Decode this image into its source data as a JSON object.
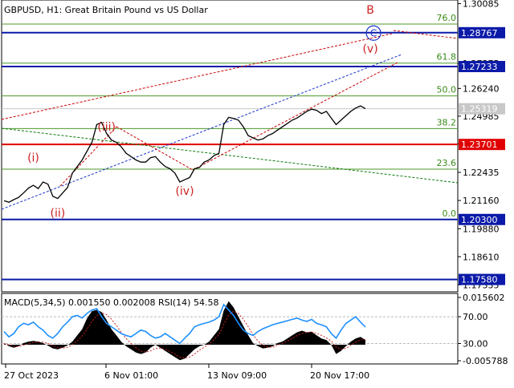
{
  "chart_data": {
    "type": "line",
    "title": "GBPUSD, H1:  Great Britain Pound vs US Dollar",
    "ylim": [
      1.1702,
      1.3025
    ],
    "y_ticks": [
      "1.30085",
      "1.27375",
      "1.26240",
      "1.24985",
      "1.23730",
      "1.22435",
      "1.21160",
      "1.19880",
      "1.18610",
      "1.17335"
    ],
    "x_labels": [
      "27 Oct 2023",
      "6 Nov 01:00",
      "13 Nov 09:00",
      "20 Nov 17:00"
    ],
    "price_boxes": [
      {
        "label": "1.28767",
        "value": 1.28767,
        "color": "#0b1aa8",
        "line": "#0b1aa8"
      },
      {
        "label": "1.27233",
        "value": 1.27233,
        "color": "#0b1aa8",
        "line": "#0b1aa8"
      },
      {
        "label": "1.25319",
        "value": 1.25319,
        "color": "#c8c8c8",
        "line": "#c8c8c8"
      },
      {
        "label": "1.23701",
        "value": 1.23701,
        "color": "#e00000",
        "line": "#e00000"
      },
      {
        "label": "1.20300",
        "value": 1.203,
        "color": "#0b1aa8",
        "line": "#0b1aa8"
      },
      {
        "label": "1.17580",
        "value": 1.1758,
        "color": "#0b1aa8",
        "line": "#0b1aa8"
      }
    ],
    "fib_levels": [
      {
        "label": "76.0",
        "value": 1.2916
      },
      {
        "label": "61.8",
        "value": 1.2739
      },
      {
        "label": "50.0",
        "value": 1.259
      },
      {
        "label": "38.2",
        "value": 1.2442
      },
      {
        "label": "23.6",
        "value": 1.2258
      },
      {
        "label": "0.0",
        "value": 1.203
      }
    ],
    "wave_labels": [
      {
        "text": "(i)",
        "t": 6,
        "v": 1.2292
      },
      {
        "text": "(ii)",
        "t": 11,
        "v": 1.2042
      },
      {
        "text": "(iii)",
        "t": 21,
        "v": 1.2432
      },
      {
        "text": "(iv)",
        "t": 37,
        "v": 1.2142
      },
      {
        "text": "(v)",
        "t": 75,
        "v": 1.2787
      },
      {
        "text": "B",
        "t": 75,
        "v": 1.2963
      },
      {
        "text": "C",
        "t": 75,
        "v": 1.2875,
        "circled": true
      }
    ],
    "series": [
      {
        "values": [
          1.2115,
          1.2108,
          1.212,
          1.213,
          1.215,
          1.2172,
          1.2185,
          1.217,
          1.22,
          1.219,
          1.2135,
          1.2125,
          1.215,
          1.2175,
          1.224,
          1.227,
          1.23,
          1.234,
          1.238,
          1.246,
          1.247,
          1.242,
          1.239,
          1.238,
          1.236,
          1.233,
          1.2315,
          1.23,
          1.229,
          1.229,
          1.231,
          1.2315,
          1.229,
          1.227,
          1.226,
          1.224,
          1.22,
          1.221,
          1.222,
          1.226,
          1.2265,
          1.229,
          1.23,
          1.232,
          1.233,
          1.246,
          1.2493,
          1.2488,
          1.248,
          1.245,
          1.241,
          1.24,
          1.239,
          1.2395,
          1.241,
          1.242,
          1.2435,
          1.245,
          1.2465,
          1.248,
          1.249,
          1.2505,
          1.252,
          1.253,
          1.2525,
          1.251,
          1.252,
          1.249,
          1.246,
          1.248,
          1.25,
          1.252,
          1.2535,
          1.2545,
          1.2532
        ]
      }
    ],
    "indicator": {
      "label": "MACD(5,34,5) 0.001550 0.002008 RSI(14) 54.58",
      "ylim": [
        -0.0062,
        0.0165
      ],
      "y_ticks": [
        "0.015602",
        "70.00",
        "30.00",
        "-0.005788"
      ],
      "macd": [
        0.0005,
        -0.0005,
        -0.001,
        -0.0005,
        0.0005,
        0.001,
        0.0012,
        0.001,
        0.0005,
        -0.0003,
        -0.0012,
        -0.0015,
        -0.001,
        -0.0002,
        0.001,
        0.003,
        0.005,
        0.0085,
        0.0108,
        0.0112,
        0.0105,
        0.008,
        0.005,
        0.003,
        0.001,
        -0.0005,
        -0.0015,
        -0.0025,
        -0.003,
        -0.0025,
        -0.001,
        0.0,
        -0.001,
        -0.002,
        -0.003,
        -0.004,
        -0.005,
        -0.0045,
        -0.003,
        -0.0015,
        -0.0005,
        0.0,
        0.001,
        0.003,
        0.005,
        0.011,
        0.014,
        0.012,
        0.009,
        0.006,
        0.003,
        0.0005,
        -0.0005,
        -0.0012,
        -0.001,
        -0.0005,
        0.0005,
        0.001,
        0.002,
        0.003,
        0.004,
        0.0045,
        0.004,
        0.0042,
        0.003,
        0.002,
        0.0015,
        0.0,
        -0.003,
        -0.002,
        -0.0005,
        0.001,
        0.002,
        0.0025,
        0.0015
      ],
      "signal": [
        0.0003,
        0.0,
        -0.0005,
        -0.0006,
        -0.0002,
        0.0003,
        0.0007,
        0.0009,
        0.0008,
        0.0004,
        -0.0003,
        -0.0009,
        -0.0011,
        -0.0008,
        0.0,
        0.0012,
        0.0028,
        0.005,
        0.0075,
        0.0093,
        0.0102,
        0.0097,
        0.0082,
        0.0062,
        0.004,
        0.002,
        0.0004,
        -0.001,
        -0.002,
        -0.0024,
        -0.002,
        -0.0012,
        -0.0011,
        -0.0015,
        -0.0022,
        -0.003,
        -0.004,
        -0.0043,
        -0.004,
        -0.003,
        -0.0018,
        -0.0008,
        0.0002,
        0.0016,
        0.0032,
        0.0065,
        0.0095,
        0.0108,
        0.01,
        0.0082,
        0.0058,
        0.0032,
        0.0012,
        -0.0002,
        -0.0008,
        -0.0008,
        -0.0002,
        0.0004,
        0.0012,
        0.002,
        0.0029,
        0.0036,
        0.0039,
        0.0041,
        0.0037,
        0.003,
        0.0022,
        0.0012,
        -0.0008,
        -0.0015,
        -0.0012,
        -0.0002,
        0.0008,
        0.0016,
        0.0016
      ],
      "rsi": [
        48,
        40,
        45,
        55,
        60,
        58,
        62,
        55,
        50,
        42,
        38,
        45,
        55,
        62,
        70,
        72,
        68,
        75,
        80,
        82,
        70,
        60,
        55,
        50,
        45,
        42,
        40,
        45,
        50,
        48,
        42,
        38,
        40,
        45,
        40,
        35,
        30,
        38,
        45,
        55,
        58,
        60,
        62,
        65,
        70,
        88,
        80,
        72,
        60,
        50,
        45,
        42,
        48,
        52,
        55,
        58,
        60,
        62,
        64,
        66,
        68,
        65,
        63,
        66,
        60,
        58,
        55,
        45,
        38,
        50,
        60,
        65,
        70,
        62,
        54.58
      ]
    }
  }
}
